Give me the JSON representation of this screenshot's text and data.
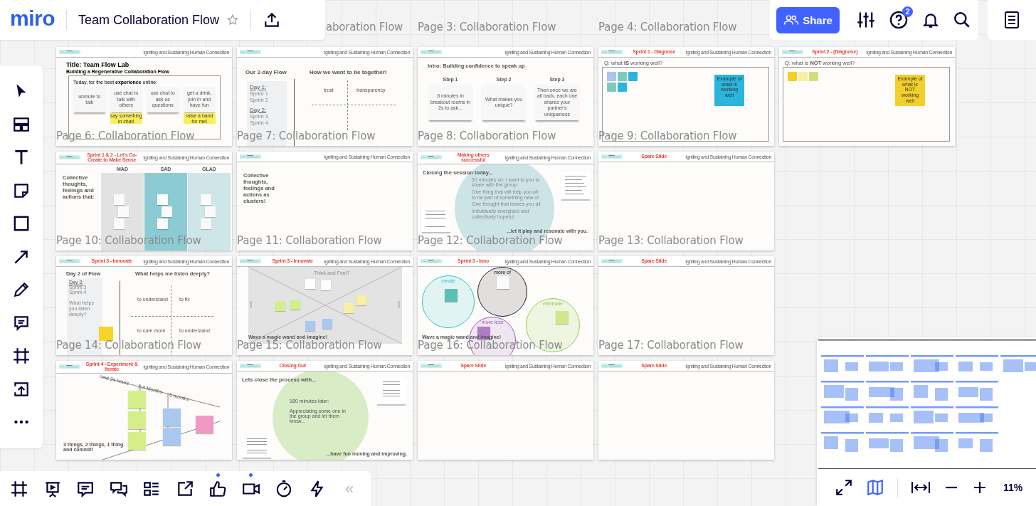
{
  "topbar": {
    "logo": "miro",
    "board_title": "Team Collaboration Flow",
    "starred": false,
    "share_label": "Share",
    "help_badge": "2"
  },
  "board": {
    "loose_labels": [
      {
        "text": "aboration Flow",
        "covered": true
      },
      {
        "text": "Page 3: Collaboration Flow",
        "covered": false
      },
      {
        "text": "Page 4: Collaboration Flow",
        "covered": false
      }
    ],
    "rows": [
      [
        {
          "label": "Page 6: Collaboration Flow",
          "slide": {
            "kind": "intro",
            "header": "Igniting and Sustaining Human Connection",
            "title": "Title: Team Flow Lab",
            "subtitle": "Building a Regenerative Collaboration Flow",
            "prompt": "Today, for the best **experience** online:",
            "cards": [
              {
                "text": "unmute to talk"
              },
              {
                "text": "use chat to talk with others",
                "sticky": "say something in chat!"
              },
              {
                "text": "use chat to ask us questions"
              },
              {
                "text": "get a drink, join in and have fun",
                "sticky": "raise a hand for me!"
              }
            ]
          }
        },
        {
          "label": "Page 7: Collaboration Flow",
          "slide": {
            "kind": "two-day",
            "header": "Igniting and Sustaining Human Connection",
            "left_title": "Our 2-day Flow",
            "days": [
              {
                "day": "Day 1:",
                "sprints": [
                  "Sprint 1",
                  "Sprint 2"
                ]
              },
              {
                "day": "Day 2:",
                "sprints": [
                  "Sprint 3",
                  "Sprint 4"
                ]
              }
            ],
            "right_title": "How we want to be together!",
            "quadrants": [
              "trust",
              "transparency"
            ]
          }
        },
        {
          "label": "Page 8: Collaboration Flow",
          "slide": {
            "kind": "steps",
            "header": "Igniting and Sustaining Human Connection",
            "title": "Intro: Building confidence to speak up",
            "steps": [
              {
                "label": "Step 1",
                "note": "5 minutes in breakout rooms in 2s to ask..."
              },
              {
                "label": "Step 2",
                "note": "What makes you unique?"
              },
              {
                "label": "Step 3",
                "note": "Then once we are all back, each one shares your partner's uniqueness"
              }
            ]
          }
        },
        {
          "label": "Page 9: Collaboration Flow",
          "slide": {
            "kind": "question",
            "tag": "Sprint 1 - Diagnose",
            "header": "Igniting and Sustaining Human Connection",
            "question": "Q: what **IS** working well?",
            "notes": [
              {
                "color": "#a9c5ef"
              },
              {
                "color": "#7fcac0"
              },
              {
                "color": "#2bb5dd"
              },
              {
                "color": "#7fcac0"
              },
              {
                "color": "#2bb5dd"
              }
            ],
            "example": {
              "text": "Example of what is working well",
              "color": "#2bb5dd"
            }
          }
        },
        {
          "slide": {
            "kind": "question",
            "tag": "Sprint 2 - (Diagnose)",
            "header": "Igniting and Sustaining Human Connection",
            "question": "Q: what is **NOT** working well?",
            "notes": [
              {
                "color": "#f2cf2a"
              },
              {
                "color": "#f8f0a0"
              },
              {
                "color": "#cfe07a"
              }
            ],
            "example": {
              "text": "Example of what is NOT working well",
              "color": "#f2cf2a"
            }
          }
        }
      ],
      [
        {
          "label": "Page 10: Collaboration Flow",
          "slide": {
            "kind": "columns",
            "tag": "Sprint 1 & 2 - Let's Co-Create to Make Sense",
            "header": "Igniting and Sustaining Human Connection",
            "left_text": "Collective thoughts, feelings and actions that:",
            "columns": [
              {
                "name": "MAD",
                "color": "#e2e2e2"
              },
              {
                "name": "SAD",
                "color": "#8ccbd3"
              },
              {
                "name": "GLAD",
                "color": "#cfe6e8"
              }
            ]
          }
        },
        {
          "label": "Page 11: Collaboration Flow",
          "slide": {
            "kind": "clusters",
            "header": "Igniting and Sustaining Human Connection",
            "left_text": "Collective thoughts, feelings and actions as clusters!"
          }
        },
        {
          "label": "Page 12: Collaboration Flow",
          "slide": {
            "kind": "closing",
            "tag": "Making others successful",
            "header": "Igniting and Sustaining Human Connection",
            "title": "**Closing** the session today...",
            "circle_lines": [
              "50 minutes on: I want to you to share with the group:",
              "One thing that will help you all to be part of something new or",
              "One thought that leaves you all",
              "individually energised and collectively hopeful."
            ],
            "footer": "...let it play and resonate with you."
          }
        },
        {
          "label": "Page 13: Collaboration Flow",
          "slide": {
            "kind": "blank",
            "tag": "Spare Slide",
            "header": "Igniting and Sustaining Human Connection"
          }
        }
      ],
      [
        {
          "label": "Page 14: Collaboration Flow",
          "slide": {
            "kind": "listen",
            "tag": "Sprint 3 - Innovate",
            "header": "Igniting and Sustaining Human Connection",
            "left_title": "Day 2 of Flow",
            "day": "Day 2:",
            "sprints": [
              "Sprint 3",
              "Sprint 4"
            ],
            "question": "What helps you listen deeply?",
            "right_title": "What helps me listen deeply?",
            "quadrants": [
              "to understand",
              "to fix",
              "to care more",
              "to understand"
            ]
          }
        },
        {
          "label": "Page 15: Collaboration Flow",
          "slide": {
            "kind": "xbox",
            "tag": "Sprint 3 - Innovate",
            "header": "Igniting and Sustaining Human Connection",
            "caption": "Think and Feel?",
            "notes": [
              {
                "color": "#ffffff"
              },
              {
                "color": "#ffffff"
              },
              {
                "color": "#d4ef8a"
              },
              {
                "color": "#d4ef8a"
              },
              {
                "color": "#f8f0a0"
              },
              {
                "color": "#f8f0a0"
              },
              {
                "color": "#a9c8f0"
              },
              {
                "color": "#a9c8f0"
              }
            ],
            "footer": "Wave a magic wand and imagine!"
          }
        },
        {
          "label": "Page 16: Collaboration Flow",
          "slide": {
            "kind": "circles",
            "tag": "Sprint 3 - Inno",
            "header": "Igniting and Sustaining Human Connection",
            "circles": [
              {
                "label": "create",
                "color": "#2ec4c4"
              },
              {
                "label": "more of",
                "color": "#222222"
              },
              {
                "label": "more less",
                "color": "#9b59b6"
              },
              {
                "label": "eliminate",
                "color": "#8fcf4a"
              }
            ],
            "footer": "Wave a magic wand and imagine!"
          }
        },
        {
          "label": "Page 17: Collaboration Flow",
          "slide": {
            "kind": "blank",
            "tag": "Spare Slide",
            "header": "Igniting and Sustaining Human Connection"
          }
        }
      ],
      [
        {
          "slide": {
            "kind": "funnel",
            "tag": "Sprint 4 - Experiment & Iterate",
            "header": "Igniting and Sustaining Human Connection",
            "stages": [
              "next 24 hours",
              "1-3 Months",
              "6 months"
            ],
            "footer": "3 things, 2 things, 1 thing and commit!"
          }
        },
        {
          "slide": {
            "kind": "closing-out",
            "tag": "Closing Out",
            "header": "Igniting and Sustaining Human Connection",
            "title": "Lets **close** the process with...",
            "circle_title": "180 minutes later:",
            "circle_text": "Appreciating some one in the group and let them know...",
            "footer": "...have fun moving and improving."
          }
        },
        {
          "slide": {
            "kind": "blank",
            "tag": "Spare Slide",
            "header": "Igniting and Sustaining Human Connection"
          }
        },
        {
          "slide": {
            "kind": "blank",
            "tag": "Spare Slide",
            "header": "Igniting and Sustaining Human Connection"
          }
        }
      ]
    ]
  },
  "bottom_tools": [
    {
      "kind": "frames",
      "active": false
    },
    {
      "kind": "present",
      "active": false
    },
    {
      "kind": "comments",
      "active": false
    },
    {
      "kind": "chat",
      "active": false
    },
    {
      "kind": "list",
      "active": false
    },
    {
      "kind": "share-out",
      "active": false
    },
    {
      "kind": "reactions",
      "active": true
    },
    {
      "kind": "video",
      "active": true
    },
    {
      "kind": "timer",
      "active": false
    },
    {
      "kind": "lightning",
      "active": false
    }
  ],
  "collapse": "«",
  "minimap": {
    "on": true,
    "zoom": "11%"
  }
}
